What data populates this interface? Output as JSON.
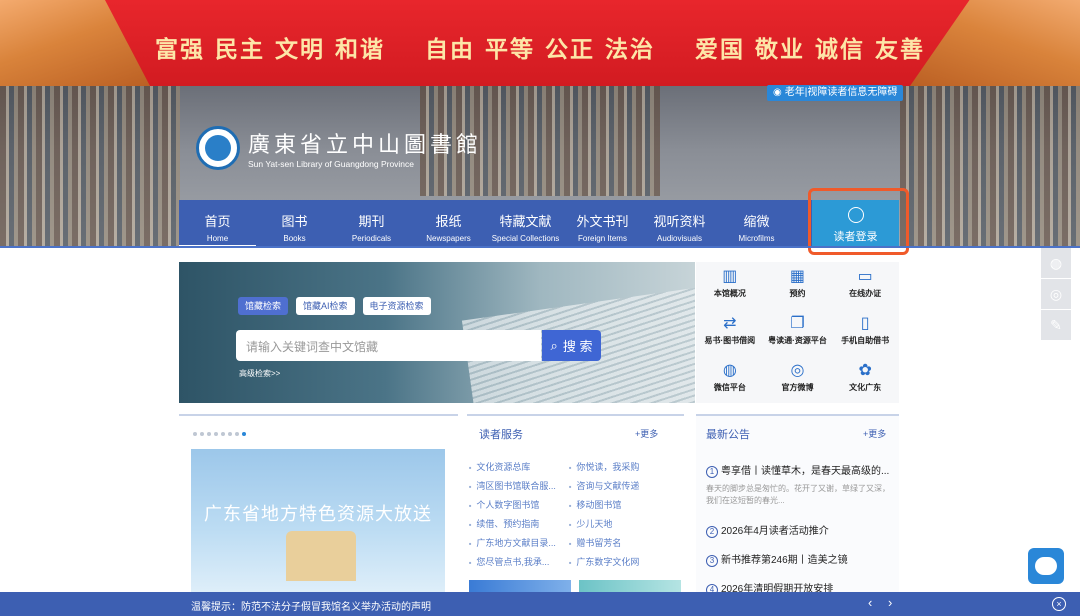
{
  "banner": {
    "slogan": [
      "富强 民主 文明 和谐",
      "自由 平等 公正 法治",
      "爱国 敬业 诚信 友善"
    ]
  },
  "header": {
    "accessibility_link": "老年|视障读者信息无障碍",
    "logo_cn": "廣東省立中山圖書館",
    "logo_en": "Sun Yat-sen Library of Guangdong Province"
  },
  "nav": {
    "items": [
      {
        "cn": "首页",
        "en": "Home"
      },
      {
        "cn": "图书",
        "en": "Books"
      },
      {
        "cn": "期刊",
        "en": "Periodicals"
      },
      {
        "cn": "报纸",
        "en": "Newspapers"
      },
      {
        "cn": "特藏文献",
        "en": "Special Collections"
      },
      {
        "cn": "外文书刊",
        "en": "Foreign Items"
      },
      {
        "cn": "视听资料",
        "en": "Audiovisuals"
      },
      {
        "cn": "缩微",
        "en": "Microfilms"
      }
    ],
    "login": "读者登录"
  },
  "search": {
    "tabs": [
      "馆藏检索",
      "馆藏AI检索",
      "电子资源检索"
    ],
    "placeholder": "请输入关键词查中文馆藏",
    "button": "搜 索",
    "advanced": "高级检索>>"
  },
  "quick": [
    {
      "label": "本馆概况",
      "icon": "library-icon"
    },
    {
      "label": "预约",
      "icon": "calendar-icon"
    },
    {
      "label": "在线办证",
      "icon": "id-card-icon"
    },
    {
      "label": "易书·图书借阅",
      "icon": "book-exchange-icon"
    },
    {
      "label": "粤读通·资源平台",
      "icon": "open-book-icon"
    },
    {
      "label": "手机自助借书",
      "icon": "mobile-icon"
    },
    {
      "label": "微信平台",
      "icon": "wechat-icon"
    },
    {
      "label": "官方微博",
      "icon": "weibo-icon"
    },
    {
      "label": "文化广东",
      "icon": "culture-icon"
    }
  ],
  "promo": {
    "text": "广东省地方特色资源大放送"
  },
  "reader_services": {
    "title": "读者服务",
    "more": "+更多",
    "items": [
      "文化资源总库",
      "你悦读，我采购",
      "湾区图书馆联合服...",
      "咨询与文献传递",
      "个人数字图书馆",
      "移动图书馆",
      "续借、预约指南",
      "少儿天地",
      "广东地方文献目录...",
      "赠书留芳名",
      "您尽管点书,我承...",
      "广东数字文化网"
    ]
  },
  "notices": {
    "title": "最新公告",
    "more": "+更多",
    "items": [
      {
        "num": "1",
        "title": "粤享借丨读懂草木，是春天最高级的...",
        "desc": "春天的脚步总是匆忙的。花开了又谢，草绿了又深，我们在这短暂的春光..."
      },
      {
        "num": "2",
        "title": "2026年4月读者活动推介",
        "desc": ""
      },
      {
        "num": "3",
        "title": "新书推荐第246期丨造美之镜",
        "desc": ""
      },
      {
        "num": "4",
        "title": "2026年清明假期开放安排",
        "desc": ""
      }
    ]
  },
  "bottom": {
    "message": "温馨提示：防范不法分子假冒我馆名义举办活动的声明",
    "arrows": "‹ ›",
    "close": "×"
  }
}
